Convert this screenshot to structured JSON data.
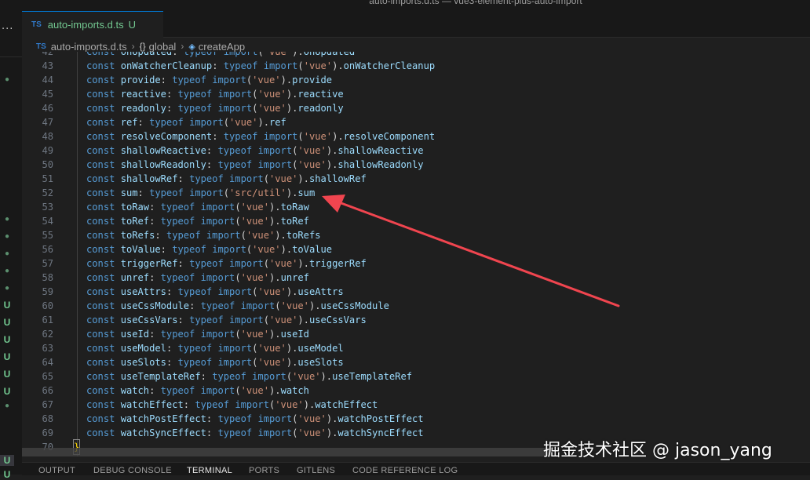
{
  "window": {
    "title": "auto-imports.d.ts — vue3-element-plus-auto-import"
  },
  "tab": {
    "badge": "TS",
    "name": "auto-imports.d.ts",
    "status": "U"
  },
  "breadcrumb": {
    "badge": "TS",
    "file": "auto-imports.d.ts",
    "scope_icon": "{}",
    "scope": "global",
    "symbol": "createApp"
  },
  "editor": {
    "lines": [
      {
        "n": "42",
        "name": "onUpdated",
        "module": "vue",
        "member": "onUpdated"
      },
      {
        "n": "43",
        "name": "onWatcherCleanup",
        "module": "vue",
        "member": "onWatcherCleanup"
      },
      {
        "n": "44",
        "name": "provide",
        "module": "vue",
        "member": "provide"
      },
      {
        "n": "45",
        "name": "reactive",
        "module": "vue",
        "member": "reactive"
      },
      {
        "n": "46",
        "name": "readonly",
        "module": "vue",
        "member": "readonly"
      },
      {
        "n": "47",
        "name": "ref",
        "module": "vue",
        "member": "ref"
      },
      {
        "n": "48",
        "name": "resolveComponent",
        "module": "vue",
        "member": "resolveComponent"
      },
      {
        "n": "49",
        "name": "shallowReactive",
        "module": "vue",
        "member": "shallowReactive"
      },
      {
        "n": "50",
        "name": "shallowReadonly",
        "module": "vue",
        "member": "shallowReadonly"
      },
      {
        "n": "51",
        "name": "shallowRef",
        "module": "vue",
        "member": "shallowRef"
      },
      {
        "n": "52",
        "name": "sum",
        "module": "src/util",
        "member": "sum"
      },
      {
        "n": "53",
        "name": "toRaw",
        "module": "vue",
        "member": "toRaw"
      },
      {
        "n": "54",
        "name": "toRef",
        "module": "vue",
        "member": "toRef"
      },
      {
        "n": "55",
        "name": "toRefs",
        "module": "vue",
        "member": "toRefs"
      },
      {
        "n": "56",
        "name": "toValue",
        "module": "vue",
        "member": "toValue"
      },
      {
        "n": "57",
        "name": "triggerRef",
        "module": "vue",
        "member": "triggerRef"
      },
      {
        "n": "58",
        "name": "unref",
        "module": "vue",
        "member": "unref"
      },
      {
        "n": "59",
        "name": "useAttrs",
        "module": "vue",
        "member": "useAttrs"
      },
      {
        "n": "60",
        "name": "useCssModule",
        "module": "vue",
        "member": "useCssModule"
      },
      {
        "n": "61",
        "name": "useCssVars",
        "module": "vue",
        "member": "useCssVars"
      },
      {
        "n": "62",
        "name": "useId",
        "module": "vue",
        "member": "useId"
      },
      {
        "n": "63",
        "name": "useModel",
        "module": "vue",
        "member": "useModel"
      },
      {
        "n": "64",
        "name": "useSlots",
        "module": "vue",
        "member": "useSlots"
      },
      {
        "n": "65",
        "name": "useTemplateRef",
        "module": "vue",
        "member": "useTemplateRef"
      },
      {
        "n": "66",
        "name": "watch",
        "module": "vue",
        "member": "watch"
      },
      {
        "n": "67",
        "name": "watchEffect",
        "module": "vue",
        "member": "watchEffect"
      },
      {
        "n": "68",
        "name": "watchPostEffect",
        "module": "vue",
        "member": "watchPostEffect"
      },
      {
        "n": "69",
        "name": "watchSyncEffect",
        "module": "vue",
        "member": "watchSyncEffect"
      }
    ],
    "closing_line": {
      "n": "70",
      "text": "}"
    }
  },
  "explorer_status": {
    "marks": [
      "●",
      "●",
      "●",
      "●",
      "●",
      "●",
      "U",
      "U",
      "U",
      "U",
      "U",
      "U",
      "●",
      "U",
      "U"
    ]
  },
  "panel": {
    "tabs": [
      "OUTPUT",
      "DEBUG CONSOLE",
      "TERMINAL",
      "PORTS",
      "GITLENS",
      "CODE REFERENCE LOG"
    ],
    "active": "TERMINAL"
  },
  "watermark": {
    "text": "掘金技术社区 @ jason_yang"
  },
  "colors": {
    "keyword": "#569cd6",
    "identifier": "#9cdcfe",
    "string": "#ce9178",
    "arrow": "#f0454f",
    "untracked": "#73c991"
  }
}
